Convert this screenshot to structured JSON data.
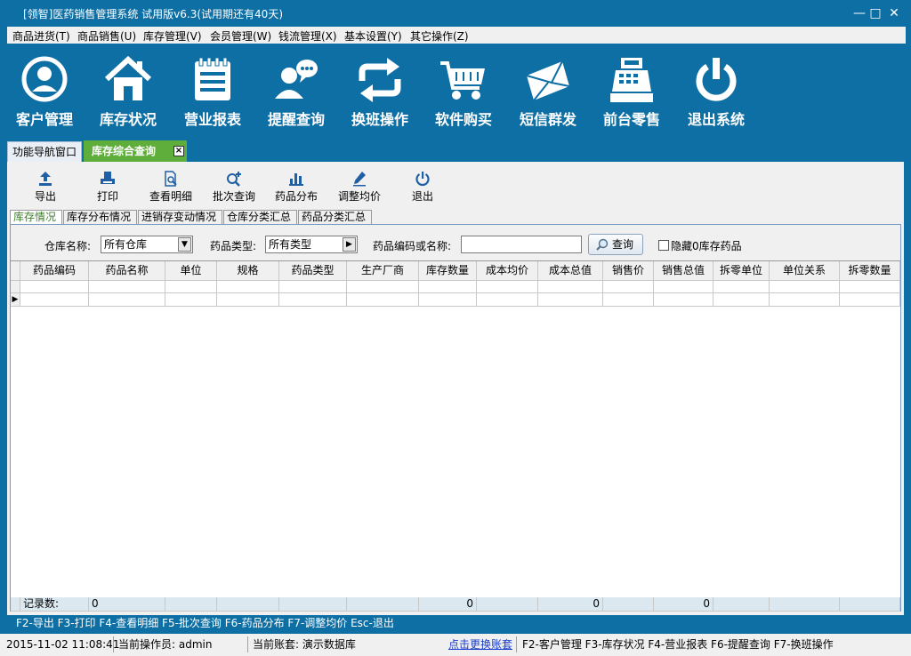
{
  "window": {
    "title": "[领智]医药销售管理系统 试用版v6.3(试用期还有40天)",
    "minimize": "—",
    "maximize": "□",
    "close": "✕"
  },
  "menu": [
    "商品进货(T)",
    "商品销售(U)",
    "库存管理(V)",
    "会员管理(W)",
    "钱流管理(X)",
    "基本设置(Y)",
    "其它操作(Z)"
  ],
  "big_toolbar": [
    {
      "label": "客户管理",
      "icon": "user-circle-icon"
    },
    {
      "label": "库存状况",
      "icon": "house-icon"
    },
    {
      "label": "营业报表",
      "icon": "notepad-icon"
    },
    {
      "label": "提醒查询",
      "icon": "users-chat-icon"
    },
    {
      "label": "换班操作",
      "icon": "swap-arrows-icon"
    },
    {
      "label": "软件购买",
      "icon": "cart-icon"
    },
    {
      "label": "短信群发",
      "icon": "envelope-icon"
    },
    {
      "label": "前台零售",
      "icon": "cash-register-icon"
    },
    {
      "label": "退出系统",
      "icon": "power-icon"
    }
  ],
  "tabs": {
    "nav": "功能导航窗口",
    "active": "库存综合查询",
    "close": "×"
  },
  "toolbar": [
    {
      "label": "导出",
      "icon": "export-icon"
    },
    {
      "label": "打印",
      "icon": "print-icon"
    },
    {
      "label": "查看明细",
      "icon": "doc-search-icon"
    },
    {
      "label": "批次查询",
      "icon": "search-plus-icon"
    },
    {
      "label": "药品分布",
      "icon": "bar-chart-icon"
    },
    {
      "label": "调整均价",
      "icon": "pencil-icon"
    },
    {
      "label": "退出",
      "icon": "power-icon"
    }
  ],
  "subtabs": [
    "库存情况",
    "库存分布情况",
    "进销存变动情况",
    "仓库分类汇总",
    "药品分类汇总"
  ],
  "filter": {
    "warehouse_label": "仓库名称:",
    "warehouse_value": "所有仓库",
    "type_label": "药品类型:",
    "type_value": "所有类型",
    "code_label": "药品编码或名称:",
    "code_value": "",
    "query_button": "查询",
    "hide_zero_label": "隐藏0库存药品"
  },
  "grid": {
    "columns": [
      "药品编码",
      "药品名称",
      "单位",
      "规格",
      "药品类型",
      "生产厂商",
      "库存数量",
      "成本均价",
      "成本总值",
      "销售价",
      "销售总值",
      "拆零单位",
      "单位关系",
      "拆零数量"
    ],
    "row_marker": "▶",
    "footer": {
      "label": "记录数:",
      "count": "0",
      "stock_qty": "0",
      "cost_total": "0",
      "sales_total": "0"
    }
  },
  "shortcuts": "F2-导出 F3-打印 F4-查看明细 F5-批次查询 F6-药品分布 F7-调整均价 Esc-退出",
  "status": {
    "datetime": "2015-11-02 11:08:41",
    "operator": "当前操作员: admin",
    "account": "当前账套: 演示数据库",
    "switch_link": "点击更换账套",
    "hotkeys": "F2-客户管理 F3-库存状况 F4-营业报表 F6-提醒查询 F7-换班操作"
  },
  "colors": {
    "frame_blue": "#0e6fa5",
    "active_tab_green": "#5fae3c",
    "panel_gray": "#f0f0f0"
  }
}
